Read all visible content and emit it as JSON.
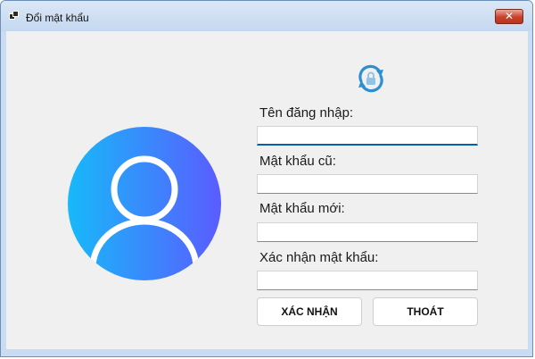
{
  "window": {
    "title": "Đổi mật khẩu",
    "close_glyph": "✕",
    "icons": {
      "app": "app-window-icon",
      "close": "close-icon"
    }
  },
  "form": {
    "username_label": "Tên đăng nhập:",
    "old_password_label": "Mật khẩu cũ:",
    "new_password_label": "Mật khẩu mới:",
    "confirm_password_label": "Xác nhận mật khẩu:",
    "username_value": "",
    "old_password_value": "",
    "new_password_value": "",
    "confirm_password_value": ""
  },
  "buttons": {
    "confirm_label": "XÁC NHẬN",
    "exit_label": "THOÁT"
  },
  "icons": {
    "avatar": "user-avatar-icon",
    "refresh_lock": "lock-refresh-icon"
  },
  "colors": {
    "avatar_gradient_start": "#17b9f9",
    "avatar_gradient_end": "#5a5cff",
    "refresh_icon": "#2d8fd0",
    "focus_accent": "#0a5ea8",
    "close_button": "#c7402a"
  }
}
